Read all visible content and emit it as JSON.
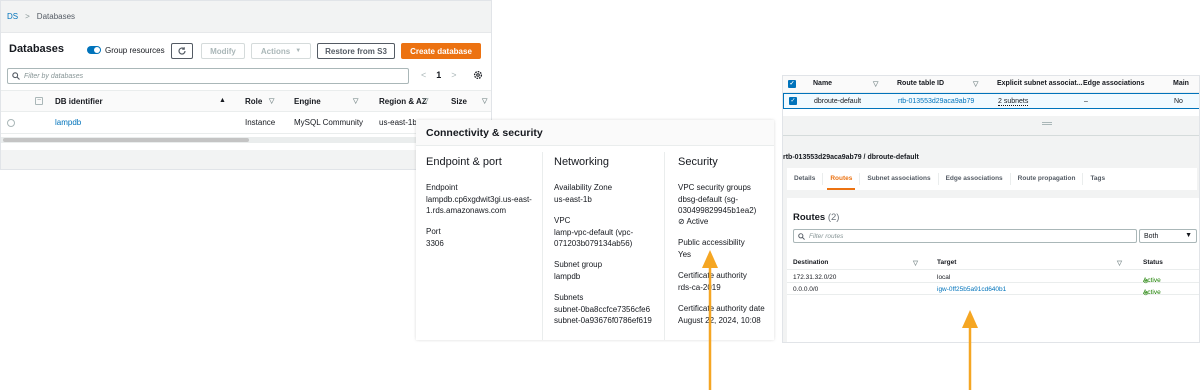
{
  "rds": {
    "breadcrumb": {
      "root": "DS",
      "current": "Databases"
    },
    "title": "Databases",
    "group_resources": "Group resources",
    "buttons": {
      "modify": "Modify",
      "actions": "Actions",
      "restore": "Restore from S3",
      "create": "Create database"
    },
    "search_placeholder": "Filter by databases",
    "pager": {
      "page": "1"
    },
    "columns": [
      "DB identifier",
      "Role",
      "Engine",
      "Region & AZ",
      "Size"
    ],
    "rows": [
      {
        "id": "lampdb",
        "role": "Instance",
        "engine": "MySQL Community",
        "region": "us-east-1b"
      }
    ]
  },
  "connectivity": {
    "title": "Connectivity & security",
    "endpoint_port": {
      "heading": "Endpoint & port",
      "endpoint_label": "Endpoint",
      "endpoint_value": "lampdb.cp6xgdwit3gi.us-east-1.rds.amazonaws.com",
      "port_label": "Port",
      "port_value": "3306"
    },
    "networking": {
      "heading": "Networking",
      "az_label": "Availability Zone",
      "az_value": "us-east-1b",
      "vpc_label": "VPC",
      "vpc_value": "lamp-vpc-default (vpc-071203b079134ab56)",
      "subnet_group_label": "Subnet group",
      "subnet_group_value": "lampdb",
      "subnets_label": "Subnets",
      "subnet_1": "subnet-0ba8ccfce7356cfe6",
      "subnet_2": "subnet-0a93676f0786ef619"
    },
    "security": {
      "heading": "Security",
      "sg_label": "VPC security groups",
      "sg_value": "dbsg-default (sg-030499829945b1ea2)",
      "sg_status": "Active",
      "public_label": "Public accessibility",
      "public_value": "Yes",
      "ca_label": "Certificate authority",
      "ca_value": "rds-ca-2019",
      "ca_date_label": "Certificate authority date",
      "ca_date_value": "August 22, 2024, 10:08"
    }
  },
  "route_tables": {
    "columns": [
      "Name",
      "Route table ID",
      "Explicit subnet associat...",
      "Edge associations",
      "Main"
    ],
    "row": {
      "name": "dbroute-default",
      "id": "rtb-013553d29aca9ab79",
      "subnets": "2 subnets",
      "edge": "–",
      "main": "No"
    },
    "detail_title": "rtb-013553d29aca9ab79 / dbroute-default",
    "tabs": [
      "Details",
      "Routes",
      "Subnet associations",
      "Edge associations",
      "Route propagation",
      "Tags"
    ],
    "routes_title": "Routes",
    "routes_count": "(2)",
    "filter_placeholder": "Filter routes",
    "filter_select": "Both",
    "route_columns": [
      "Destination",
      "Target",
      "Status"
    ],
    "routes": [
      {
        "destination": "172.31.32.0/20",
        "target": "local",
        "status": "Active"
      },
      {
        "destination": "0.0.0.0/0",
        "target": "igw-0ff25b5a91cd640b1",
        "status": "Active"
      }
    ]
  },
  "colors": {
    "accent": "#ec7211",
    "link": "#0073bb",
    "active": "#1d8102",
    "arrow": "#f5a623"
  }
}
